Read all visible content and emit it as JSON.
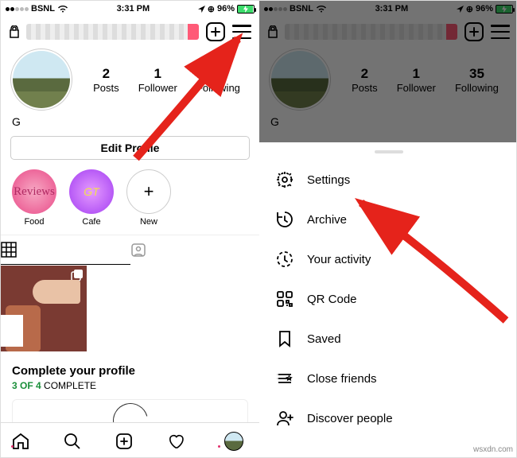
{
  "statusbar": {
    "carrier": "BSNL",
    "time": "3:31 PM",
    "battery_pct": "96%"
  },
  "header": {
    "add_label": "Create",
    "menu_label": "Menu"
  },
  "profile": {
    "stats": {
      "posts": {
        "count": "2",
        "label": "Posts"
      },
      "followers": {
        "count": "1",
        "label": "Follower"
      },
      "following": {
        "count": "35",
        "label": "Following"
      }
    },
    "display_name": "G",
    "edit_button": "Edit Profile"
  },
  "highlights": [
    {
      "label": "Food",
      "badge": "Reviews"
    },
    {
      "label": "Cafe",
      "badge": "GT"
    },
    {
      "label": "New",
      "badge": "+"
    }
  ],
  "complete_profile": {
    "title": "Complete your profile",
    "done": "3 OF 4",
    "suffix": "COMPLETE"
  },
  "menu": {
    "settings": "Settings",
    "archive": "Archive",
    "activity": "Your activity",
    "qrcode": "QR Code",
    "saved": "Saved",
    "close_friends": "Close friends",
    "discover": "Discover people"
  },
  "watermark": "wsxdn.com"
}
